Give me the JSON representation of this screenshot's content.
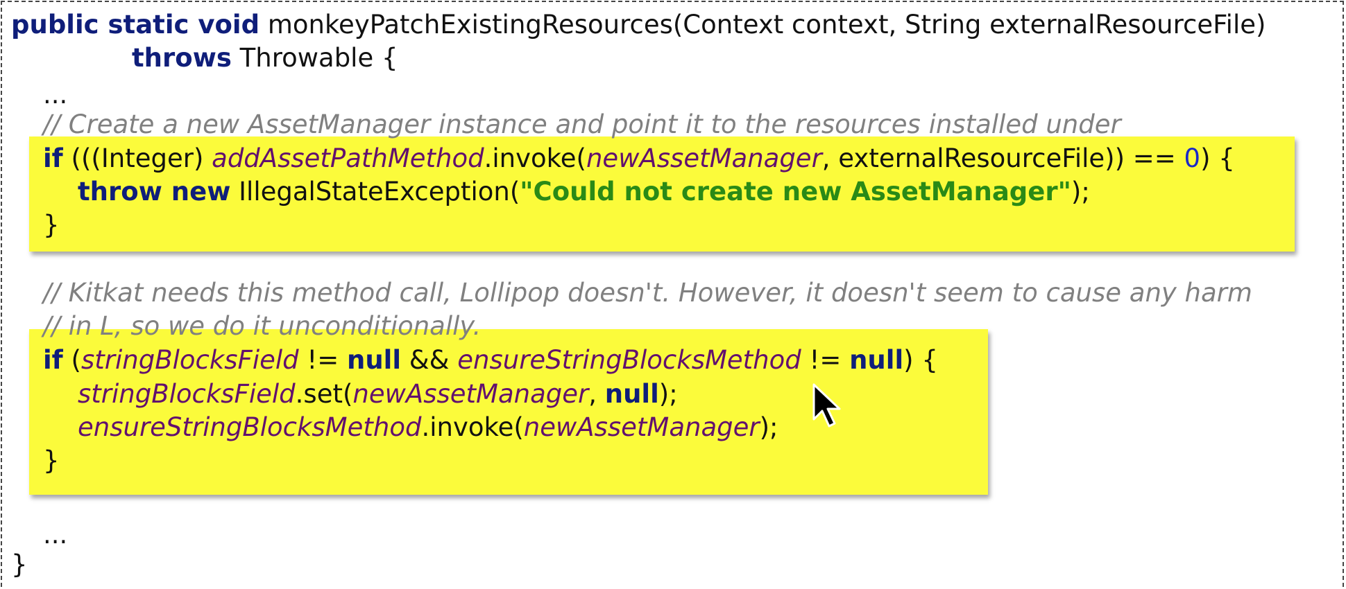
{
  "code": {
    "l1": {
      "kw": "public static void",
      "rest": " monkeyPatchExistingResources(Context context, String externalResourceFile)"
    },
    "l2": {
      "kw": "throws",
      "rest": " Throwable {"
    },
    "ellipsis_top": "...",
    "comment1": "// Create a new AssetManager instance and point it to the resources installed under",
    "b1l1": {
      "kw": "if",
      "p1": " (((Integer) ",
      "field": "addAssetPathMethod",
      "p2": ".invoke(",
      "var": "newAssetManager",
      "p3": ", externalResourceFile)) == ",
      "num": "0",
      "p4": ") {"
    },
    "b1l2": {
      "kw": "throw new",
      "p1": " IllegalStateException(",
      "str": "\"Could not create new AssetManager\"",
      "p2": ");"
    },
    "b1l3": "}",
    "comment2": "// Kitkat needs this method call, Lollipop doesn't. However, it doesn't seem to cause any harm",
    "comment3": "// in L, so we do it unconditionally.",
    "b2l1": {
      "kw": "if",
      "p1": " (",
      "f1": "stringBlocksField",
      "p2": " != ",
      "null1": "null",
      "p3": " && ",
      "f2": "ensureStringBlocksMethod",
      "p4": " != ",
      "null2": "null",
      "p5": ") {"
    },
    "b2l2": {
      "f1": "stringBlocksField",
      "p1": ".set(",
      "var": "newAssetManager",
      "p2": ", ",
      "null": "null",
      "p3": ");"
    },
    "b2l3": {
      "f1": "ensureStringBlocksMethod",
      "p1": ".invoke(",
      "var": "newAssetManager",
      "p2": ");"
    },
    "b2l4": "}",
    "ellipsis_bottom": "...",
    "close": "}"
  },
  "colors": {
    "highlight": "#fbfb3b",
    "keyword": "#0f1e7a",
    "field": "#62106e",
    "string": "#2a8a16",
    "comment": "#808080",
    "number": "#1a28c8"
  }
}
